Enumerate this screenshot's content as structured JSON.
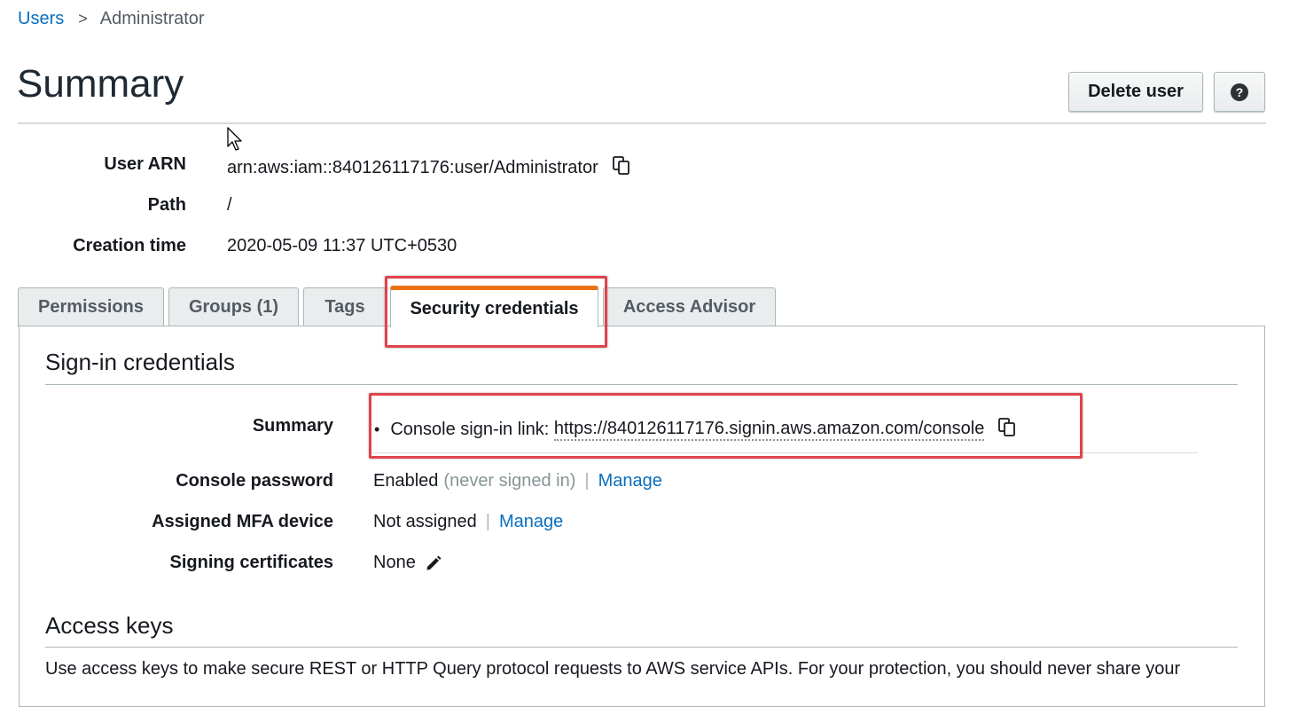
{
  "breadcrumb": {
    "parent": "Users",
    "separator": ">",
    "current": "Administrator"
  },
  "page": {
    "title": "Summary"
  },
  "actions": {
    "delete_label": "Delete user",
    "help_label": "?"
  },
  "summary": {
    "user_arn_label": "User ARN",
    "user_arn_value": "arn:aws:iam::840126117176:user/Administrator",
    "path_label": "Path",
    "path_value": "/",
    "creation_label": "Creation time",
    "creation_value": "2020-05-09 11:37 UTC+0530"
  },
  "tabs": [
    {
      "label": "Permissions"
    },
    {
      "label": "Groups (1)"
    },
    {
      "label": "Tags"
    },
    {
      "label": "Security credentials"
    },
    {
      "label": "Access Advisor"
    }
  ],
  "active_tab": "Security credentials",
  "signin": {
    "section_title": "Sign-in credentials",
    "summary_label": "Summary",
    "console_link_prefix": "Console sign-in link: ",
    "console_link_url": "https://840126117176.signin.aws.amazon.com/console",
    "password_label": "Console password",
    "password_status": "Enabled",
    "password_note": "(never signed in)",
    "password_manage": "Manage",
    "mfa_label": "Assigned MFA device",
    "mfa_value": "Not assigned",
    "mfa_manage": "Manage",
    "certs_label": "Signing certificates",
    "certs_value": "None",
    "pipe": "|"
  },
  "access_keys": {
    "section_title": "Access keys",
    "description": "Use access keys to make secure REST or HTTP Query protocol requests to AWS service APIs. For your protection, you should never share your"
  },
  "colors": {
    "link": "#0a6ebd",
    "active_tab_accent": "#ec7211",
    "highlight_box": "#e0434c"
  },
  "icons": [
    "chevron-right-icon",
    "help-icon",
    "copy-icon",
    "pencil-icon",
    "mouse-cursor-icon"
  ]
}
